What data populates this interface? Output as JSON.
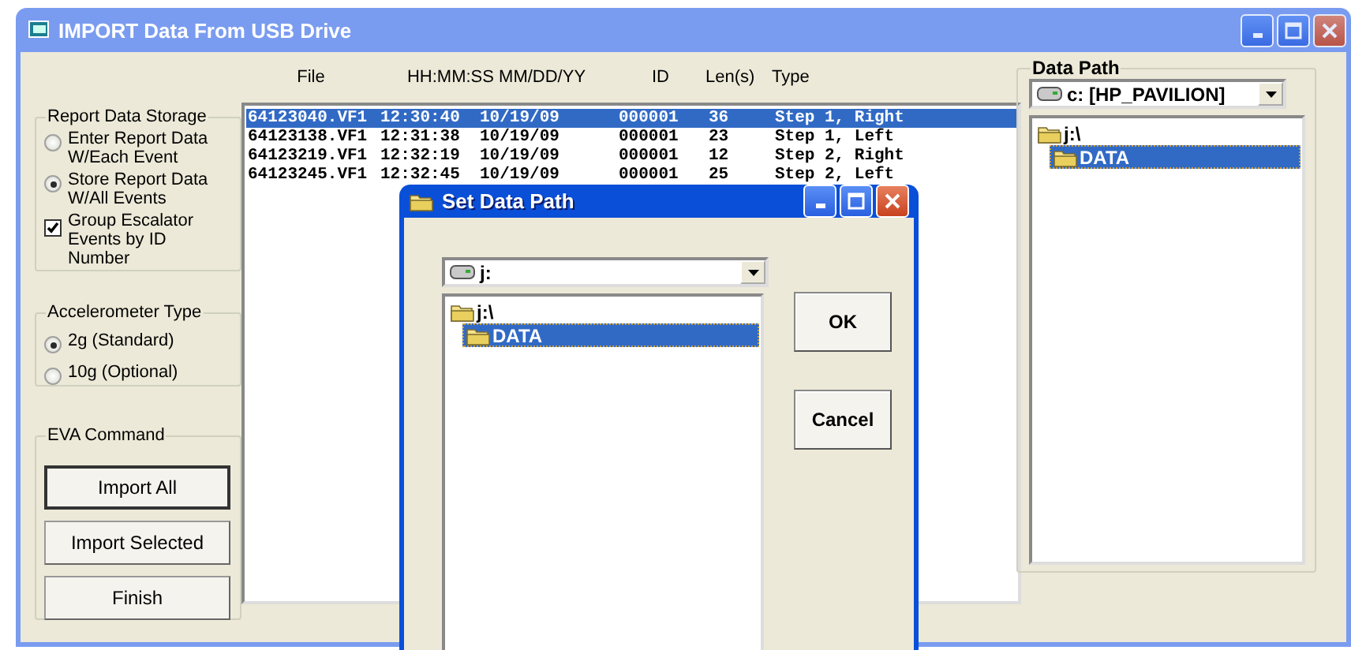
{
  "window": {
    "title": "IMPORT Data From USB Drive"
  },
  "report_data_storage": {
    "title": "Report Data Storage",
    "options": [
      {
        "label": "Enter Report Data\nW/Each Event",
        "selected": false
      },
      {
        "label": "Store Report Data\nW/All Events",
        "selected": true
      }
    ],
    "group_by_id": {
      "label": "Group Escalator\nEvents by ID Number",
      "checked": true
    }
  },
  "accelerometer_type": {
    "title": "Accelerometer Type",
    "options": [
      {
        "label": "2g (Standard)",
        "selected": true
      },
      {
        "label": "10g (Optional)",
        "selected": false
      }
    ]
  },
  "eva_command": {
    "title": "EVA Command",
    "buttons": [
      {
        "label": "Import All",
        "default": true
      },
      {
        "label": "Import Selected",
        "default": false
      },
      {
        "label": "Finish",
        "default": false
      }
    ]
  },
  "file_list": {
    "columns": [
      "File",
      "HH:MM:SS MM/DD/YY",
      "ID",
      "Len(s)",
      "Type"
    ],
    "rows": [
      {
        "cells": [
          "64123040.VF1",
          "12:30:40  10/19/09",
          "000001",
          "36",
          "Step 1, Right"
        ],
        "selected": true
      },
      {
        "cells": [
          "64123138.VF1",
          "12:31:38  10/19/09",
          "000001",
          "23",
          "Step 1, Left"
        ],
        "selected": false
      },
      {
        "cells": [
          "64123219.VF1",
          "12:32:19  10/19/09",
          "000001",
          "12",
          "Step 2, Right"
        ],
        "selected": false
      },
      {
        "cells": [
          "64123245.VF1",
          "12:32:45  10/19/09",
          "000001",
          "25",
          "Step 2, Left"
        ],
        "selected": false
      }
    ]
  },
  "data_path": {
    "title": "Data Path",
    "drive": "c: [HP_PAVILION]",
    "tree": [
      {
        "label": "j:\\",
        "selected": false,
        "children": [
          {
            "label": "DATA",
            "selected": true
          }
        ]
      }
    ]
  },
  "dialog": {
    "title": "Set Data Path",
    "drive": "j:",
    "tree": [
      {
        "label": "j:\\",
        "selected": false,
        "children": [
          {
            "label": "DATA",
            "selected": true
          }
        ]
      }
    ],
    "buttons": [
      "OK",
      "Cancel"
    ]
  }
}
